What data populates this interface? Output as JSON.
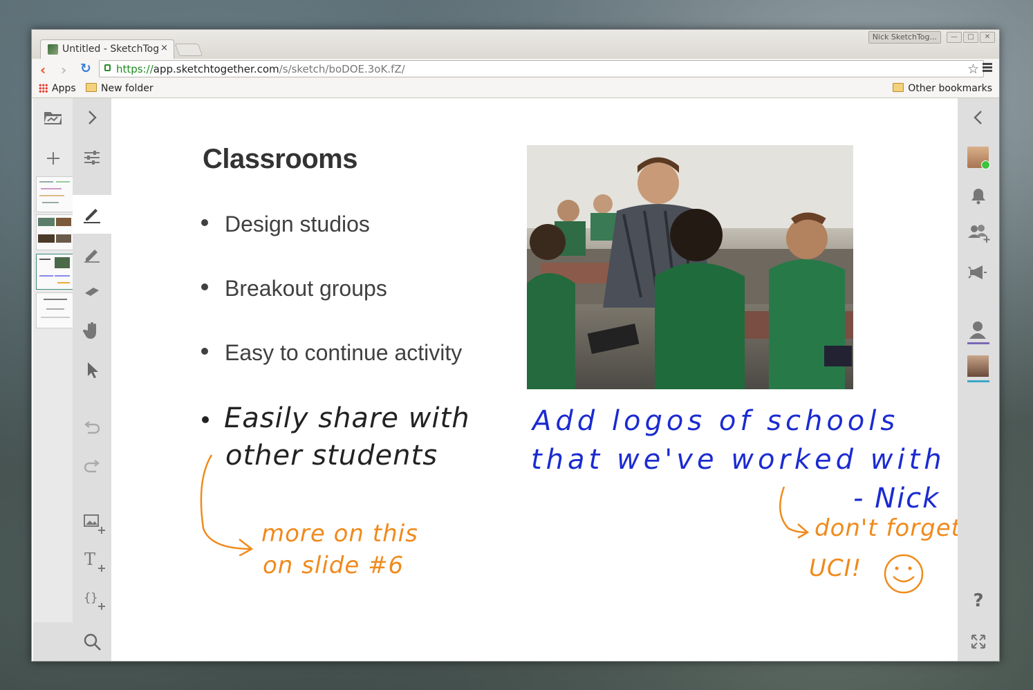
{
  "browser": {
    "tab_title": "Untitled - SketchTog",
    "tab_close": "×",
    "profile_badge": "Nick SketchTog...",
    "url_protocol": "https://",
    "url_host": "app.sketchtogether.com",
    "url_path": "/s/sketch/boDOE.3oK.fZ/",
    "bookmarks": {
      "apps": "Apps",
      "new_folder": "New folder",
      "other_bookmarks": "Other bookmarks"
    }
  },
  "slide": {
    "title": "Classrooms",
    "bullets": [
      "Design studios",
      "Breakout groups",
      "Easy to continue activity"
    ]
  },
  "annotations": {
    "handwritten_bullet_line1": "Easily share with",
    "handwritten_bullet_line2": "other students",
    "orange_note_line1": "more on this",
    "orange_note_line2": "on slide #6",
    "blue_note_line1": "Add logos of schools",
    "blue_note_line2": "that we've worked with",
    "blue_signature": "- Nick",
    "orange_reply_line1": "don't forget",
    "orange_reply_line2": "UCI!"
  },
  "icons": {
    "left": [
      "folder-open-icon",
      "chevron-right-icon",
      "plus-icon",
      "sliders-icon",
      "pen-icon",
      "highlighter-icon",
      "eraser-icon",
      "hand-icon",
      "pointer-icon",
      "undo-icon",
      "redo-icon",
      "add-image-icon",
      "add-text-icon",
      "add-code-icon",
      "search-icon"
    ],
    "right": [
      "chevron-left-icon",
      "avatar",
      "bell-icon",
      "add-group-icon",
      "megaphone-icon",
      "user-icon",
      "help-icon",
      "fullscreen-icon"
    ]
  },
  "help_label": "?",
  "colors": {
    "ink_blue": "#1b2bd1",
    "ink_orange": "#f08a1c",
    "online_green": "#3ec43e",
    "presence_purple": "#7b68b5",
    "presence_teal": "#3aa8c8"
  }
}
